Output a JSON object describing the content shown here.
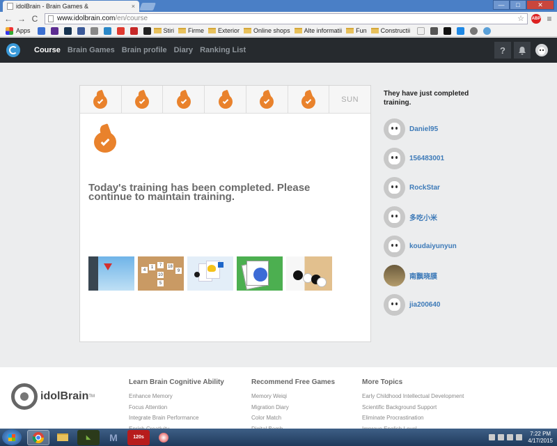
{
  "browser": {
    "tab_title": "idolBrain - Brain Games &",
    "tab_close": "×",
    "win_min": "—",
    "win_max": "□",
    "win_close": "✕",
    "back": "←",
    "forward": "→",
    "reload": "C",
    "url_host": "www.idolbrain.com",
    "url_path": "/en/course",
    "star": "☆",
    "abp_label": "ABP",
    "menu": "≡"
  },
  "bookmarks": {
    "apps_label": "Apps",
    "folders": [
      "Stiri",
      "Firme",
      "Exterior",
      "Online shops",
      "Alte informatii",
      "Fun",
      "Constructii"
    ]
  },
  "site_nav": {
    "items": [
      "Course",
      "Brain Games",
      "Brain profile",
      "Diary",
      "Ranking List"
    ],
    "help": "?"
  },
  "week": {
    "days_completed": 6,
    "last_day_label": "SUN"
  },
  "main": {
    "completed_message": "Today's training has been completed. Please continue to maintain training."
  },
  "game_tiles": [
    "1",
    "7",
    "4",
    "18",
    "9",
    "10",
    "5"
  ],
  "sidebar": {
    "title": "They have just completed training.",
    "users": [
      "Daniel95",
      "156483001",
      "RockStar",
      "多吃小米",
      "koudaiyunyun",
      "南飘晓膜",
      "jia200640"
    ]
  },
  "footer": {
    "logo_text": "idolBrain",
    "trademark": "TM",
    "columns": [
      {
        "title": "Learn Brain Cognitive Ability",
        "links": [
          "Enhance Memory",
          "Focus Attention",
          "Integrate Brain Performance",
          "Enrich Creativity"
        ]
      },
      {
        "title": "Recommend Free Games",
        "links": [
          "Memory Weiqi",
          "Migration Diary",
          "Color Match",
          "Digital Bomb"
        ]
      },
      {
        "title": "More Topics",
        "links": [
          "Early Childhood Intellectual Development",
          "Scientific Background Support",
          "Eliminate Procrastination",
          "Improve English Level"
        ]
      }
    ]
  },
  "taskbar": {
    "time": "7:22 PM",
    "date": "4/17/2015",
    "items": [
      "chrome",
      "folder",
      "nvidia",
      "M",
      "120s",
      "globe"
    ]
  }
}
